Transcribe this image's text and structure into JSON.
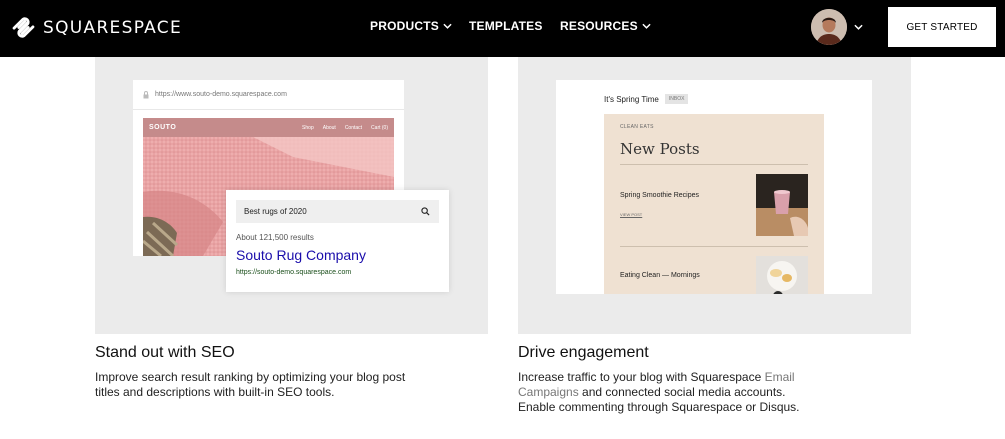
{
  "header": {
    "brand": "SQUARESPACE",
    "nav": [
      {
        "label": "PRODUCTS",
        "has_dropdown": true
      },
      {
        "label": "TEMPLATES",
        "has_dropdown": false
      },
      {
        "label": "RESOURCES",
        "has_dropdown": true
      }
    ],
    "cta_label": "GET STARTED",
    "icons": {
      "logo": "squarespace-logo-icon",
      "chevron": "chevron-down-icon"
    }
  },
  "seo_card": {
    "url": "https://www.souto-demo.squarespace.com",
    "site_logo": "SOUTO",
    "site_nav": [
      "Shop",
      "About",
      "Contact",
      "Cart (0)"
    ],
    "search_query": "Best rugs of 2020",
    "result_count": "About 121,500 results",
    "result_title": "Souto Rug Company",
    "result_url": "https://souto-demo.squarespace.com",
    "caption_title": "Stand out with SEO",
    "caption_body": "Improve search result ranking by optimizing your blog post titles and descriptions with built-in SEO tools."
  },
  "engagement_card": {
    "email_subject": "It's Spring Time",
    "inbox_badge": "INBOX",
    "eyebrow": "CLEAN EATS",
    "heading": "New Posts",
    "post1_title": "Spring Smoothie Recipes",
    "post1_link": "VIEW POST",
    "post2_title": "Eating Clean — Mornings",
    "caption_title": "Drive engagement",
    "caption_body_1": "Increase traffic to your blog with Squarespace ",
    "caption_link": "Email Campaigns",
    "caption_body_2": " and connected social media accounts. Enable commenting through Squarespace or Disqus."
  },
  "colors": {
    "header_bg": "#000000",
    "card_bg": "#ebebeb",
    "site_bar": "#c58b8b",
    "result_title": "#1a0dab",
    "newsletter_bg": "#efe1d2"
  }
}
